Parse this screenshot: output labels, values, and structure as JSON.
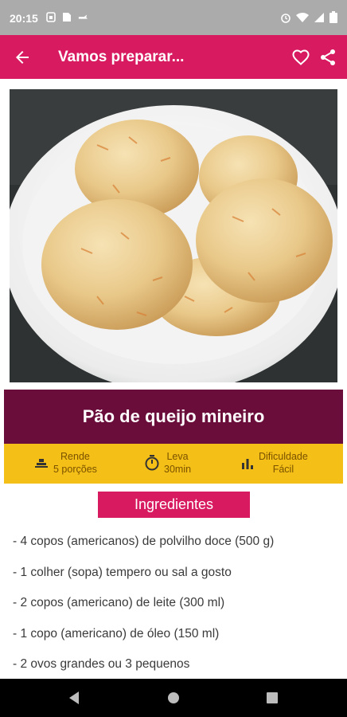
{
  "status_bar": {
    "time": "20:15",
    "left_icons": [
      "sim-icon",
      "file-icon",
      "rabbit-icon"
    ],
    "right_icons": [
      "alarm-icon",
      "wifi-icon",
      "signal-icon",
      "battery-icon"
    ]
  },
  "app_bar": {
    "title": "Vamos preparar...",
    "color": "#d81b60",
    "icons": [
      "back-arrow-icon",
      "heart-icon",
      "share-icon"
    ]
  },
  "recipe": {
    "title": "Pão de queijo mineiro",
    "title_band_color": "#6a0d3b",
    "info_band_color": "#f4bf16",
    "yield_label": "Rende",
    "yield_value": "5 porções",
    "time_label": "Leva",
    "time_value": "30min",
    "difficulty_label": "Dificuldade",
    "difficulty_value": "Fácil"
  },
  "ingredients": {
    "header": "Ingredientes",
    "items": [
      "- 4 copos (americanos) de polvilho doce (500 g)",
      "- 1 colher (sopa) tempero ou sal a gosto",
      "- 2 copos (americano) de leite (300 ml)",
      "- 1 copo (americano) de óleo (150 ml)",
      "- 2 ovos grandes ou 3 pequenos"
    ]
  },
  "nav_bar": {
    "icons": [
      "back-triangle-icon",
      "home-circle-icon",
      "recents-square-icon"
    ]
  }
}
